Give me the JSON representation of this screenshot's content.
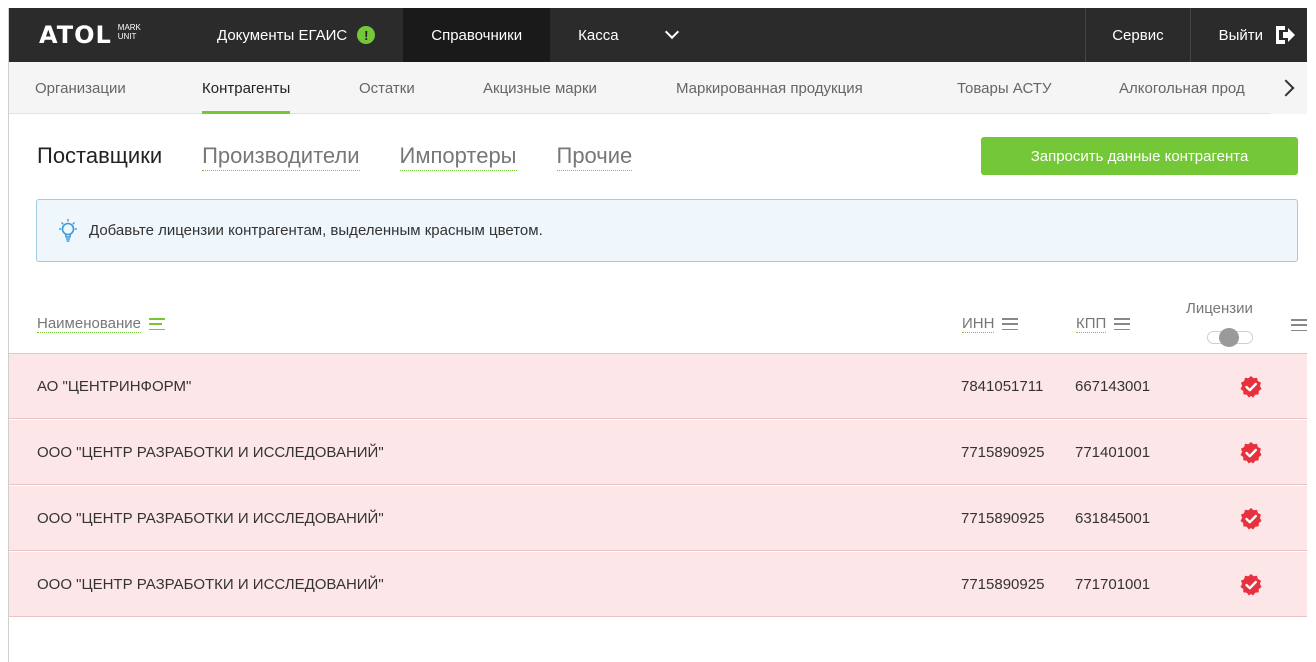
{
  "topbar": {
    "logo_main": "ATOL",
    "logo_sub_1": "MARK",
    "logo_sub_2": "UNIT",
    "items": [
      {
        "label": "Документы ЕГАИС"
      },
      {
        "label": "Справочники"
      },
      {
        "label": "Касса"
      }
    ],
    "warning_badge": "!",
    "service_label": "Сервис",
    "logout_label": "Выйти"
  },
  "subnav": {
    "items": [
      {
        "label": "Организации"
      },
      {
        "label": "Контрагенты"
      },
      {
        "label": "Остатки"
      },
      {
        "label": "Акцизные марки"
      },
      {
        "label": "Маркированная продукция"
      },
      {
        "label": "Товары АСТУ"
      },
      {
        "label": "Алкогольная прод"
      }
    ],
    "active_index": 1
  },
  "tabs": [
    {
      "label": "Поставщики"
    },
    {
      "label": "Производители"
    },
    {
      "label": "Импортеры"
    },
    {
      "label": "Прочие"
    }
  ],
  "request_button": "Запросить данные контрагента",
  "info_message": "Добавьте лицензии контрагентам, выделенным красным цветом.",
  "table": {
    "columns": {
      "name": "Наименование",
      "inn": "ИНН",
      "kpp": "КПП",
      "licenses": "Лицензии"
    },
    "rows": [
      {
        "name": "АО \"ЦЕНТРИНФОРМ\"",
        "inn": "7841051711",
        "kpp": "667143001"
      },
      {
        "name": "ООО \"ЦЕНТР РАЗРАБОТКИ И ИССЛЕДОВАНИЙ\"",
        "inn": "7715890925",
        "kpp": "771401001"
      },
      {
        "name": "ООО \"ЦЕНТР РАЗРАБОТКИ И ИССЛЕДОВАНИЙ\"",
        "inn": "7715890925",
        "kpp": "631845001"
      },
      {
        "name": "ООО \"ЦЕНТР РАЗРАБОТКИ И ИССЛЕДОВАНИЙ\"",
        "inn": "7715890925",
        "kpp": "771701001"
      }
    ]
  },
  "colors": {
    "accent_green": "#74c837",
    "topbar_bg": "#2b2b2b",
    "row_error_bg": "#fde6e8",
    "license_badge": "#e8313e"
  }
}
